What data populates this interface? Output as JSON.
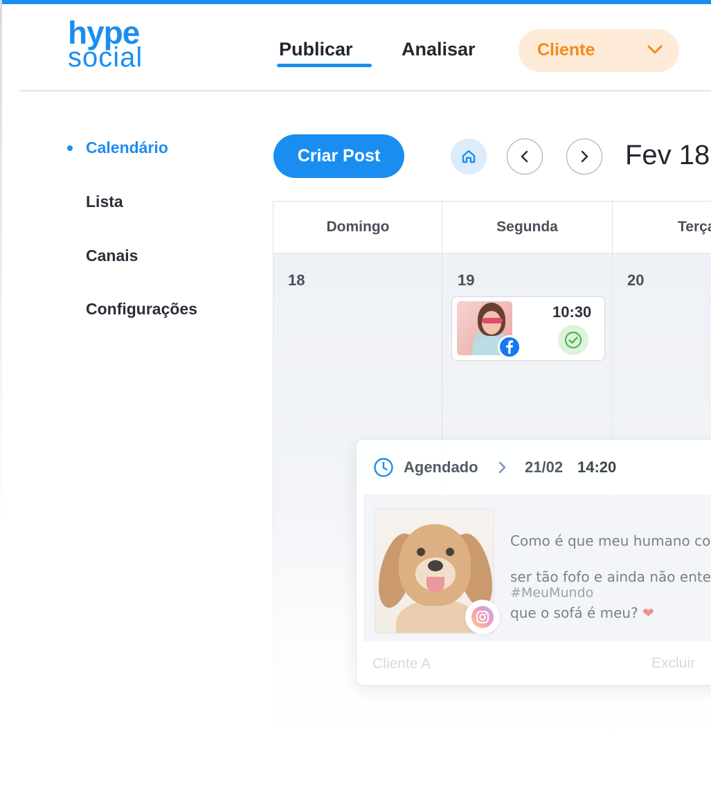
{
  "brand": {
    "line1": "hype",
    "line2": "social",
    "accent": "#1a8ef0"
  },
  "nav": {
    "tabs": [
      {
        "label": "Publicar",
        "active": true
      },
      {
        "label": "Analisar",
        "active": false
      }
    ],
    "client_select": {
      "value": "Cliente",
      "color": "#f5891c",
      "icon": "chevron-down-icon"
    }
  },
  "sidebar": {
    "items": [
      {
        "label": "Calendário",
        "active": true
      },
      {
        "label": "Lista",
        "active": false
      },
      {
        "label": "Canais",
        "active": false
      },
      {
        "label": "Configurações",
        "active": false
      }
    ]
  },
  "toolbar": {
    "create_label": "Criar Post",
    "home_icon": "home-icon",
    "prev_icon": "chevron-left-icon",
    "next_icon": "chevron-right-icon",
    "period": "Fev 18"
  },
  "calendar": {
    "columns": [
      {
        "weekday": "Domingo",
        "day": "18"
      },
      {
        "weekday": "Segunda",
        "day": "19"
      },
      {
        "weekday": "Terça",
        "day": "20"
      }
    ],
    "posts": [
      {
        "day": "19",
        "time": "10:30",
        "network": "facebook",
        "status_icon": "check-circle-icon"
      }
    ]
  },
  "post_detail": {
    "status": "Agendado",
    "date": "21/02",
    "time": "14:20",
    "caption_lines": [
      "Como é que meu humano con",
      "ser tão fofo e ainda não enten",
      "que o sofá é meu? ❤"
    ],
    "hashtag": "#MeuMundo",
    "network": "instagram",
    "client": "Cliente A",
    "delete_label": "Excluir"
  }
}
